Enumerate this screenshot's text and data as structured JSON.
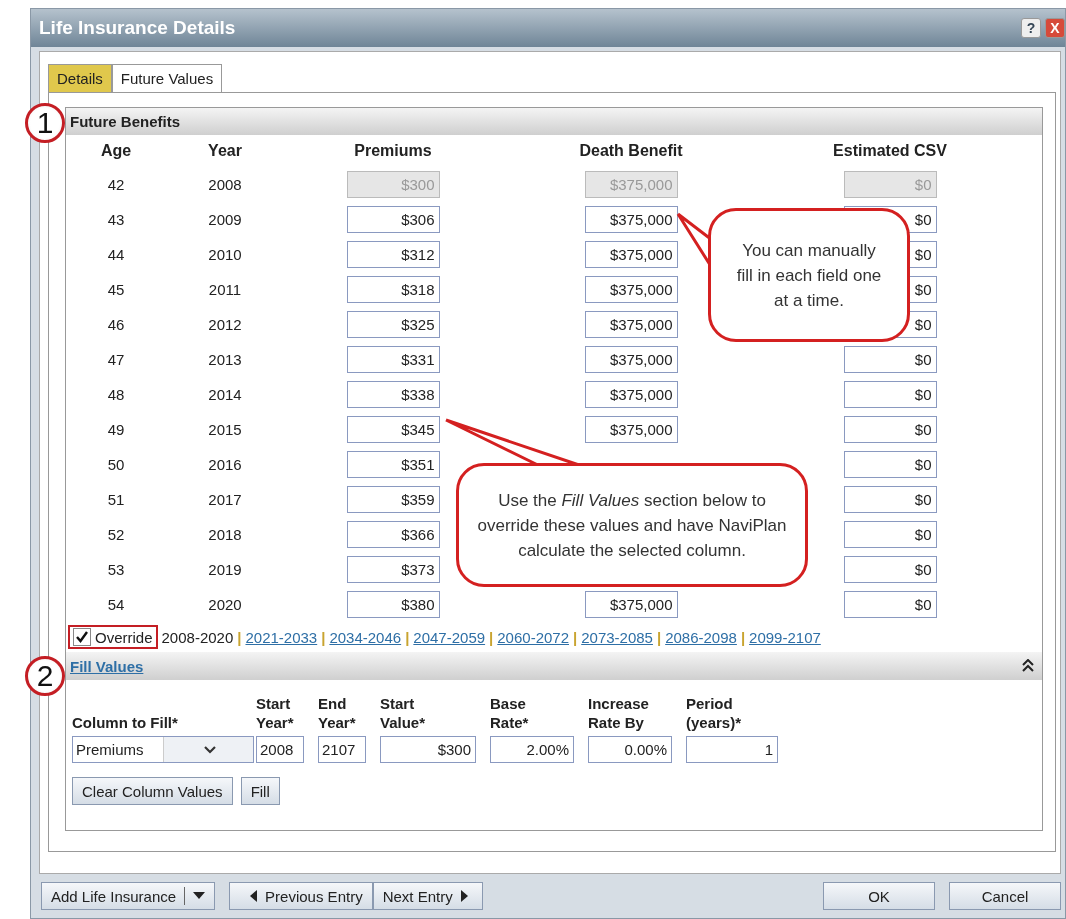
{
  "window": {
    "title": "Life Insurance Details",
    "help_button": "?",
    "close_button": "X"
  },
  "tabs": [
    {
      "label": "Details",
      "selected": false
    },
    {
      "label": "Future Values",
      "selected": true
    }
  ],
  "future_benefits": {
    "title": "Future Benefits",
    "columns": [
      "Age",
      "Year",
      "Premiums",
      "Death Benefit",
      "Estimated CSV"
    ],
    "rows": [
      {
        "age": "42",
        "year": "2008",
        "premium": "$300",
        "death_benefit": "$375,000",
        "csv": "$0",
        "disabled": true
      },
      {
        "age": "43",
        "year": "2009",
        "premium": "$306",
        "death_benefit": "$375,000",
        "csv": "$0",
        "disabled": false
      },
      {
        "age": "44",
        "year": "2010",
        "premium": "$312",
        "death_benefit": "$375,000",
        "csv": "$0",
        "disabled": false
      },
      {
        "age": "45",
        "year": "2011",
        "premium": "$318",
        "death_benefit": "$375,000",
        "csv": "$0",
        "disabled": false
      },
      {
        "age": "46",
        "year": "2012",
        "premium": "$325",
        "death_benefit": "$375,000",
        "csv": "$0",
        "disabled": false
      },
      {
        "age": "47",
        "year": "2013",
        "premium": "$331",
        "death_benefit": "$375,000",
        "csv": "$0",
        "disabled": false
      },
      {
        "age": "48",
        "year": "2014",
        "premium": "$338",
        "death_benefit": "$375,000",
        "csv": "$0",
        "disabled": false
      },
      {
        "age": "49",
        "year": "2015",
        "premium": "$345",
        "death_benefit": "$375,000",
        "csv": "$0",
        "disabled": false
      },
      {
        "age": "50",
        "year": "2016",
        "premium": "$351",
        "csv": "$0",
        "disabled": false
      },
      {
        "age": "51",
        "year": "2017",
        "premium": "$359",
        "csv": "$0",
        "disabled": false
      },
      {
        "age": "52",
        "year": "2018",
        "premium": "$366",
        "csv": "$0",
        "disabled": false
      },
      {
        "age": "53",
        "year": "2019",
        "premium": "$373",
        "csv": "$0",
        "disabled": false
      },
      {
        "age": "54",
        "year": "2020",
        "premium": "$380",
        "death_benefit": "$375,000",
        "csv": "$0",
        "disabled": false
      }
    ],
    "override": {
      "label": "Override",
      "checked": true
    },
    "ranges": [
      {
        "label": "2008-2020",
        "selected": true
      },
      {
        "separator": "|",
        "label": "2021-2033",
        "selected": false
      },
      {
        "separator": "|",
        "label": "2034-2046",
        "selected": false
      },
      {
        "separator": "|",
        "label": "2047-2059",
        "selected": false
      },
      {
        "separator": "|",
        "label": "2060-2072",
        "selected": false
      },
      {
        "separator": "|",
        "label": "2073-2085",
        "selected": false
      },
      {
        "separator": "|",
        "label": "2086-2098",
        "selected": false
      },
      {
        "separator": "|",
        "label": "2099-2107",
        "selected": false
      }
    ]
  },
  "fill_values": {
    "title": "Fill Values",
    "fields": [
      {
        "kind": "select",
        "label": "Column to Fill*",
        "value": "Premiums"
      },
      {
        "kind": "text",
        "label": "Start Year*",
        "value": "2008"
      },
      {
        "kind": "text",
        "label": "End Year*",
        "value": "2107"
      },
      {
        "kind": "text",
        "label": "Start Value*",
        "value": "$300"
      },
      {
        "kind": "text",
        "label": "Base Rate*",
        "value": "2.00%"
      },
      {
        "kind": "text",
        "label": "Increase Rate By",
        "value": "0.00%"
      },
      {
        "kind": "text",
        "label": "Period (years)*",
        "value": "1"
      }
    ],
    "buttons": [
      "Clear Column Values",
      "Fill"
    ]
  },
  "footer": {
    "add_button": "Add Life Insurance",
    "previous_button": "Previous Entry",
    "next_button": "Next Entry",
    "ok_button": "OK",
    "cancel_button": "Cancel"
  },
  "annotations": {
    "markers": [
      "1",
      "2"
    ],
    "callouts": [
      "You can manually fill in each field one at a time.",
      "Use the *Fill Values* section below to override these values and have NaviPlan calculate the selected column."
    ]
  }
}
